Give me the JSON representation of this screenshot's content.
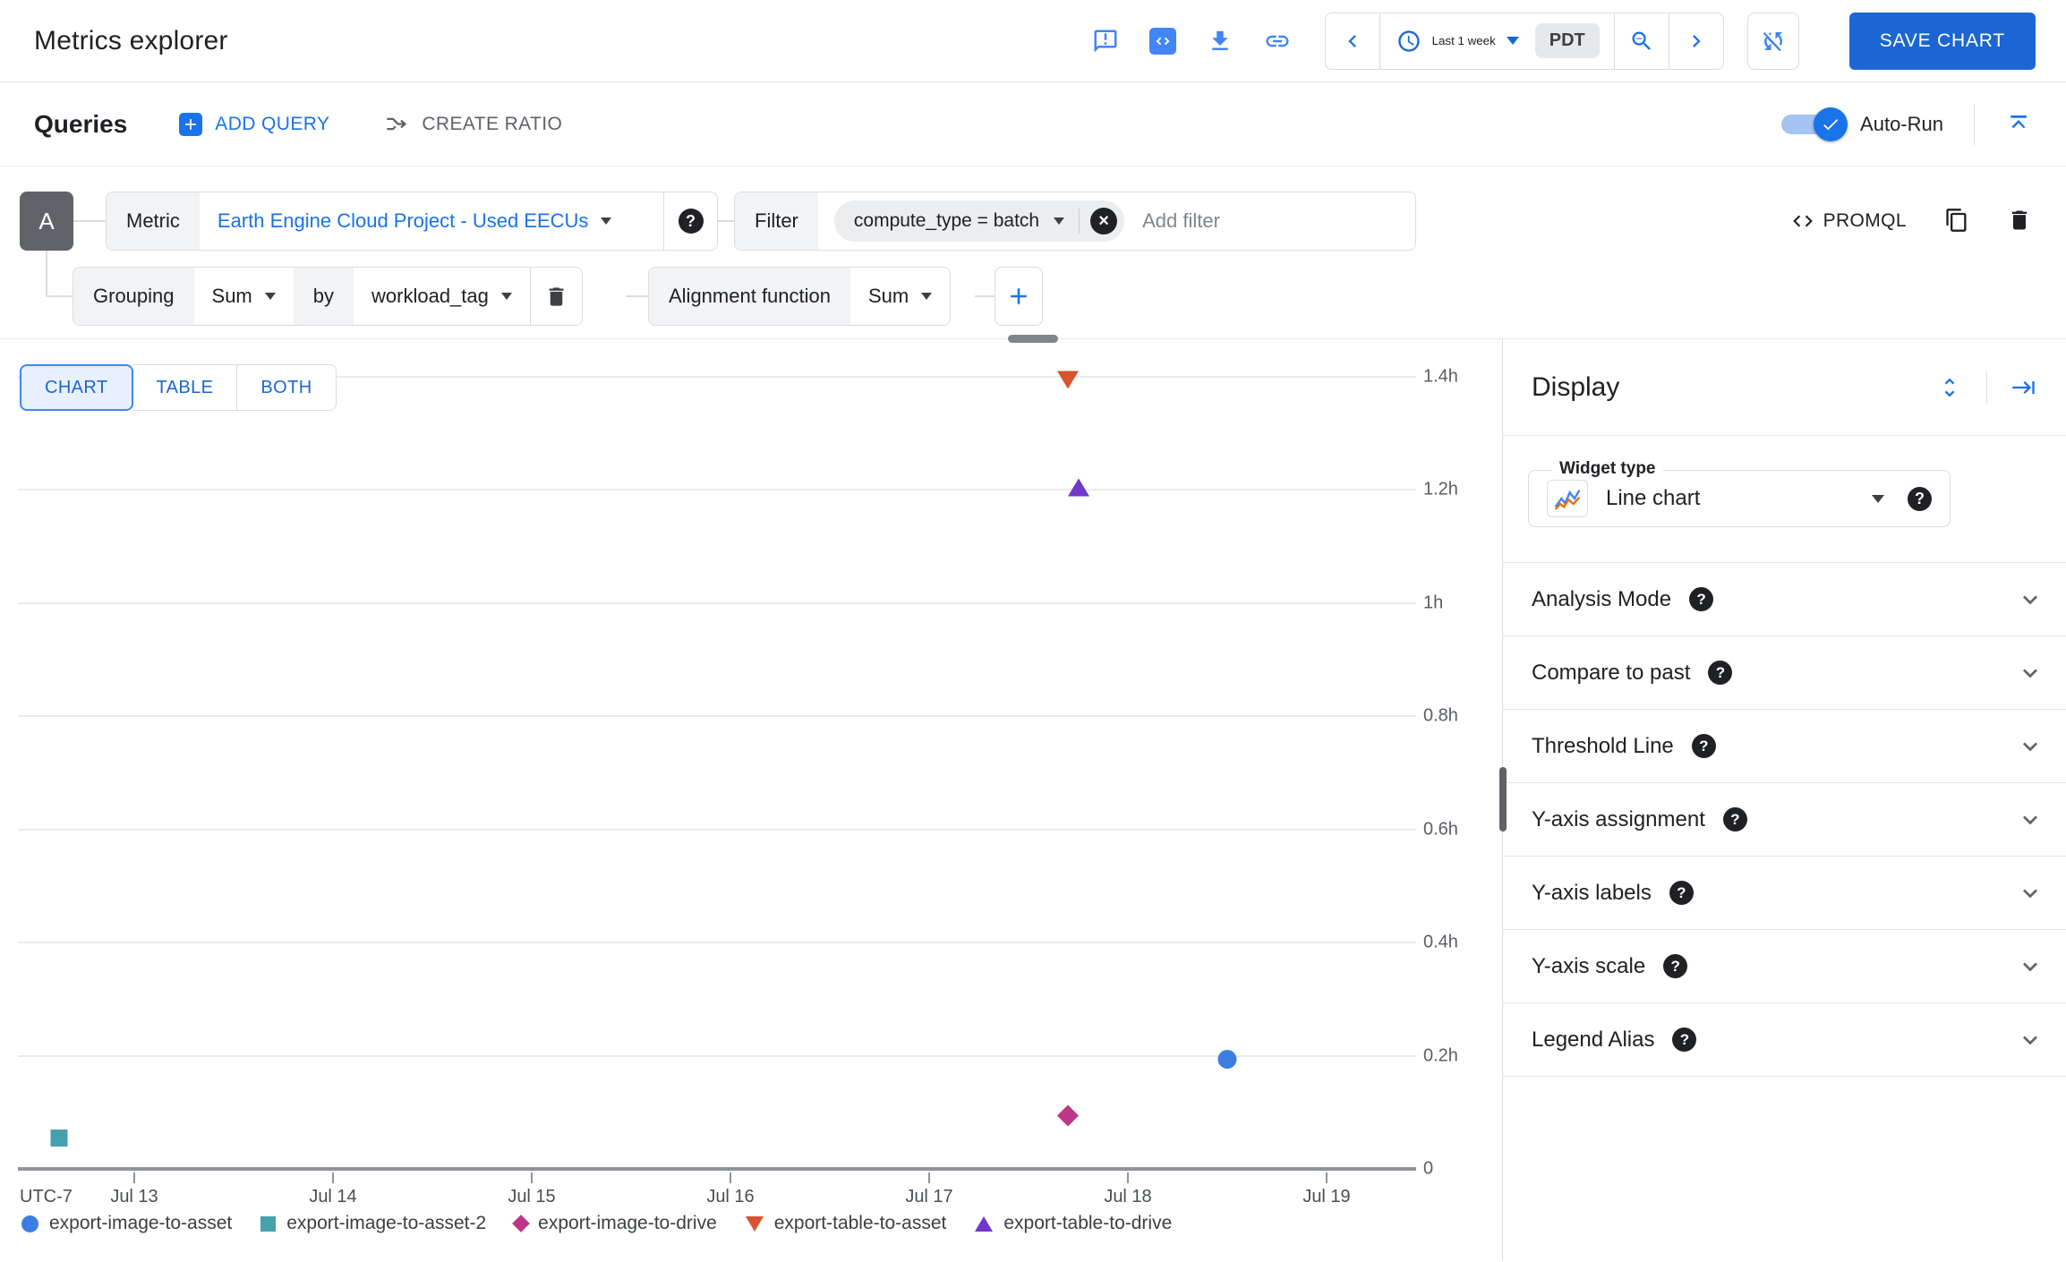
{
  "header": {
    "title": "Metrics explorer",
    "time_range_label": "Last 1 week",
    "timezone_badge": "PDT",
    "save_button_label": "SAVE CHART"
  },
  "queries_bar": {
    "title": "Queries",
    "add_query_label": "ADD QUERY",
    "create_ratio_label": "CREATE RATIO",
    "auto_run_label": "Auto-Run",
    "auto_run_enabled": true
  },
  "query_builder": {
    "query_letter": "A",
    "metric_label": "Metric",
    "metric_value": "Earth Engine Cloud Project - Used EECUs",
    "filter_label": "Filter",
    "filter_chip_value": "compute_type = batch",
    "add_filter_placeholder": "Add filter",
    "promql_label": "PROMQL",
    "grouping_label": "Grouping",
    "grouping_value": "Sum",
    "grouping_by_label": "by",
    "grouping_by_value": "workload_tag",
    "alignment_label": "Alignment function",
    "alignment_value": "Sum"
  },
  "view_tabs": {
    "tabs": [
      "CHART",
      "TABLE",
      "BOTH"
    ],
    "active": "CHART"
  },
  "chart_data": {
    "type": "scatter",
    "title": "",
    "x_axis": {
      "prefix_label": "UTC-7",
      "tick_labels": [
        "Jul 13",
        "Jul 14",
        "Jul 15",
        "Jul 16",
        "Jul 17",
        "Jul 18",
        "Jul 19"
      ],
      "tick_days": [
        13,
        14,
        15,
        16,
        17,
        18,
        19
      ]
    },
    "y_axis": {
      "unit": "hours",
      "tick_labels": [
        "1.4h",
        "1.2h",
        "1h",
        "0.8h",
        "0.6h",
        "0.4h",
        "0.2h",
        "0"
      ],
      "tick_values": [
        1.4,
        1.2,
        1.0,
        0.8,
        0.6,
        0.4,
        0.2,
        0
      ],
      "range": [
        0,
        1.45
      ]
    },
    "grid": true,
    "legend_position": "bottom",
    "series": [
      {
        "name": "export-image-to-asset",
        "marker": "circle",
        "color": "#3c7de2",
        "points": [
          {
            "day": 18.5,
            "hours": 0.19
          }
        ]
      },
      {
        "name": "export-image-to-asset-2",
        "marker": "square",
        "color": "#47a0ae",
        "points": [
          {
            "day": 12.62,
            "hours": 0.05
          }
        ]
      },
      {
        "name": "export-image-to-drive",
        "marker": "diamond",
        "color": "#bd3788",
        "points": [
          {
            "day": 17.7,
            "hours": 0.09
          }
        ]
      },
      {
        "name": "export-table-to-asset",
        "marker": "triangle-down",
        "color": "#d8532f",
        "points": [
          {
            "day": 17.7,
            "hours": 1.39
          }
        ]
      },
      {
        "name": "export-table-to-drive",
        "marker": "triangle-up",
        "color": "#7138c8",
        "points": [
          {
            "day": 17.75,
            "hours": 1.2
          }
        ]
      }
    ]
  },
  "display_panel": {
    "title": "Display",
    "widget_type_label": "Widget type",
    "widget_type_value": "Line chart",
    "sections": [
      "Analysis Mode",
      "Compare to past",
      "Threshold Line",
      "Y-axis assignment",
      "Y-axis labels",
      "Y-axis scale",
      "Legend Alias"
    ]
  },
  "colors": {
    "accent_blue": "#1a73e8",
    "link_blue": "#1967d2",
    "save_button_blue": "#1b66d2",
    "active_tab_bg": "#e8f0fe",
    "chip_gray": "#5f6368"
  },
  "icons": {
    "header": [
      "feedback-icon",
      "code-icon",
      "download-icon",
      "link-icon",
      "chevron-left-icon",
      "clock-icon",
      "zoom-out-icon",
      "chevron-right-icon",
      "auto-refresh-off-icon"
    ],
    "queries_bar": [
      "add-icon",
      "create-ratio-icon",
      "check-icon",
      "collapse-all-icon"
    ],
    "query_builder": [
      "help-icon",
      "remove-filter-icon",
      "code-icon",
      "copy-icon",
      "delete-icon",
      "add-icon"
    ],
    "display_panel": [
      "expand-sections-icon",
      "collapse-panel-icon",
      "line-chart-icon",
      "help-icon",
      "chevron-down-icon"
    ]
  }
}
